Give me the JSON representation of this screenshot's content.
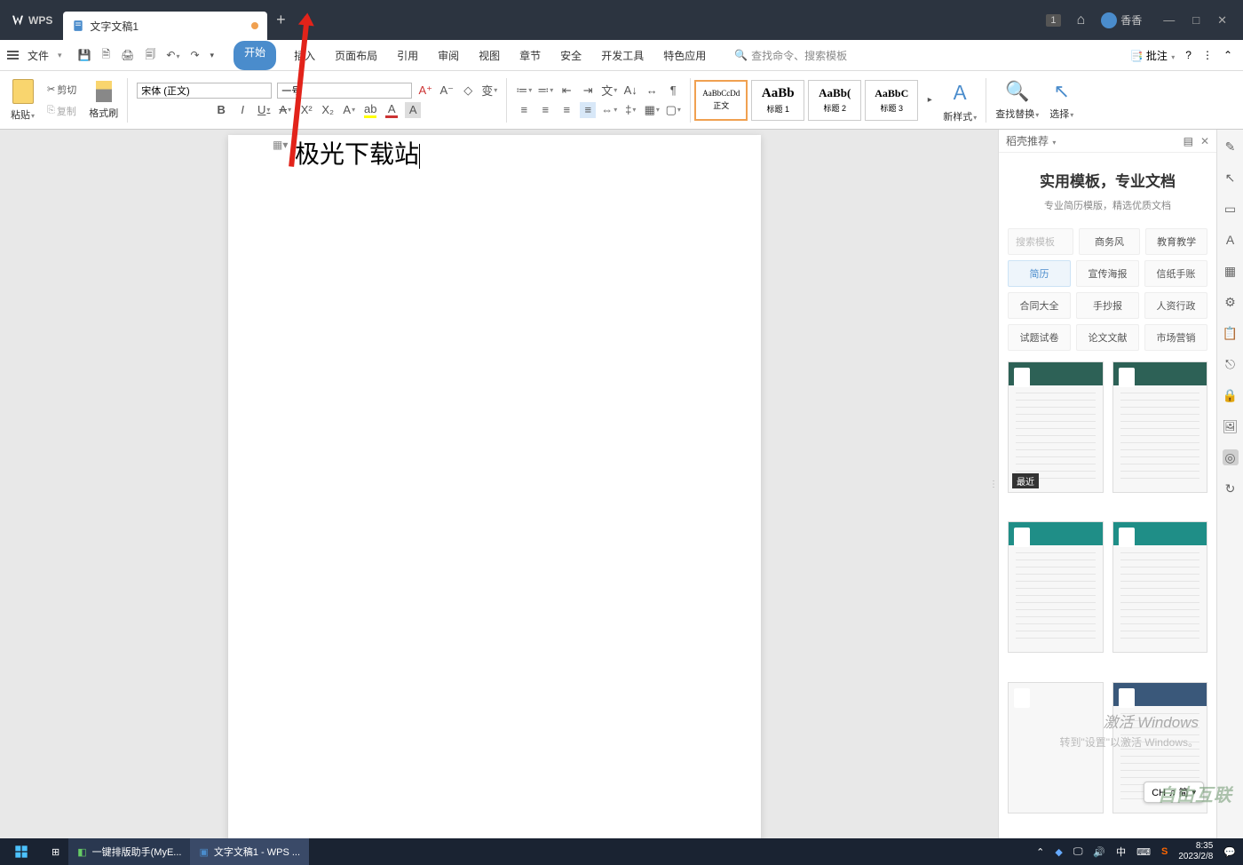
{
  "title_bar": {
    "logo_text": "WPS",
    "tab_name": "文字文稿1",
    "one_badge": "1",
    "user_name": "香香"
  },
  "menu": {
    "file": "文件",
    "tabs": [
      "开始",
      "插入",
      "页面布局",
      "引用",
      "审阅",
      "视图",
      "章节",
      "安全",
      "开发工具",
      "特色应用"
    ],
    "search_placeholder": "查找命令、搜索模板",
    "comments": "批注"
  },
  "ribbon": {
    "paste": "粘贴",
    "cut": "剪切",
    "copy": "复制",
    "format_brush": "格式刷",
    "font_name": "宋体 (正文)",
    "font_size": "一号",
    "styles": {
      "body": {
        "preview": "AaBbCcDd",
        "label": "正文"
      },
      "h1": {
        "preview": "AaBb",
        "label": "标题 1"
      },
      "h2": {
        "preview": "AaBb(",
        "label": "标题 2"
      },
      "h3": {
        "preview": "AaBbC",
        "label": "标题 3"
      }
    },
    "new_style": "新样式",
    "find_replace": "查找替换",
    "select": "选择"
  },
  "document": {
    "text": "极光下载站"
  },
  "side_panel": {
    "title": "稻壳推荐",
    "promo_title": "实用模板，专业文档",
    "promo_sub": "专业简历模版，精选优质文档",
    "search_ph": "搜索模板",
    "top_chips": [
      "商务风",
      "教育教学"
    ],
    "cats": [
      [
        "简历",
        "宣传海报",
        "信纸手账"
      ],
      [
        "合同大全",
        "手抄报",
        "人资行政"
      ],
      [
        "试题试卷",
        "论文文献",
        "市场营销"
      ]
    ],
    "recent_tag": "最近"
  },
  "watermark": {
    "l1": "激活 Windows",
    "l2": "转到\"设置\"以激活 Windows。"
  },
  "ime": {
    "text": "CH ♫ 简"
  },
  "taskbar": {
    "app1": "一键排版助手(MyE...",
    "app2": "文字文稿1 - WPS ...",
    "time": "8:35",
    "date": "2023/2/8",
    "lang": "中"
  }
}
